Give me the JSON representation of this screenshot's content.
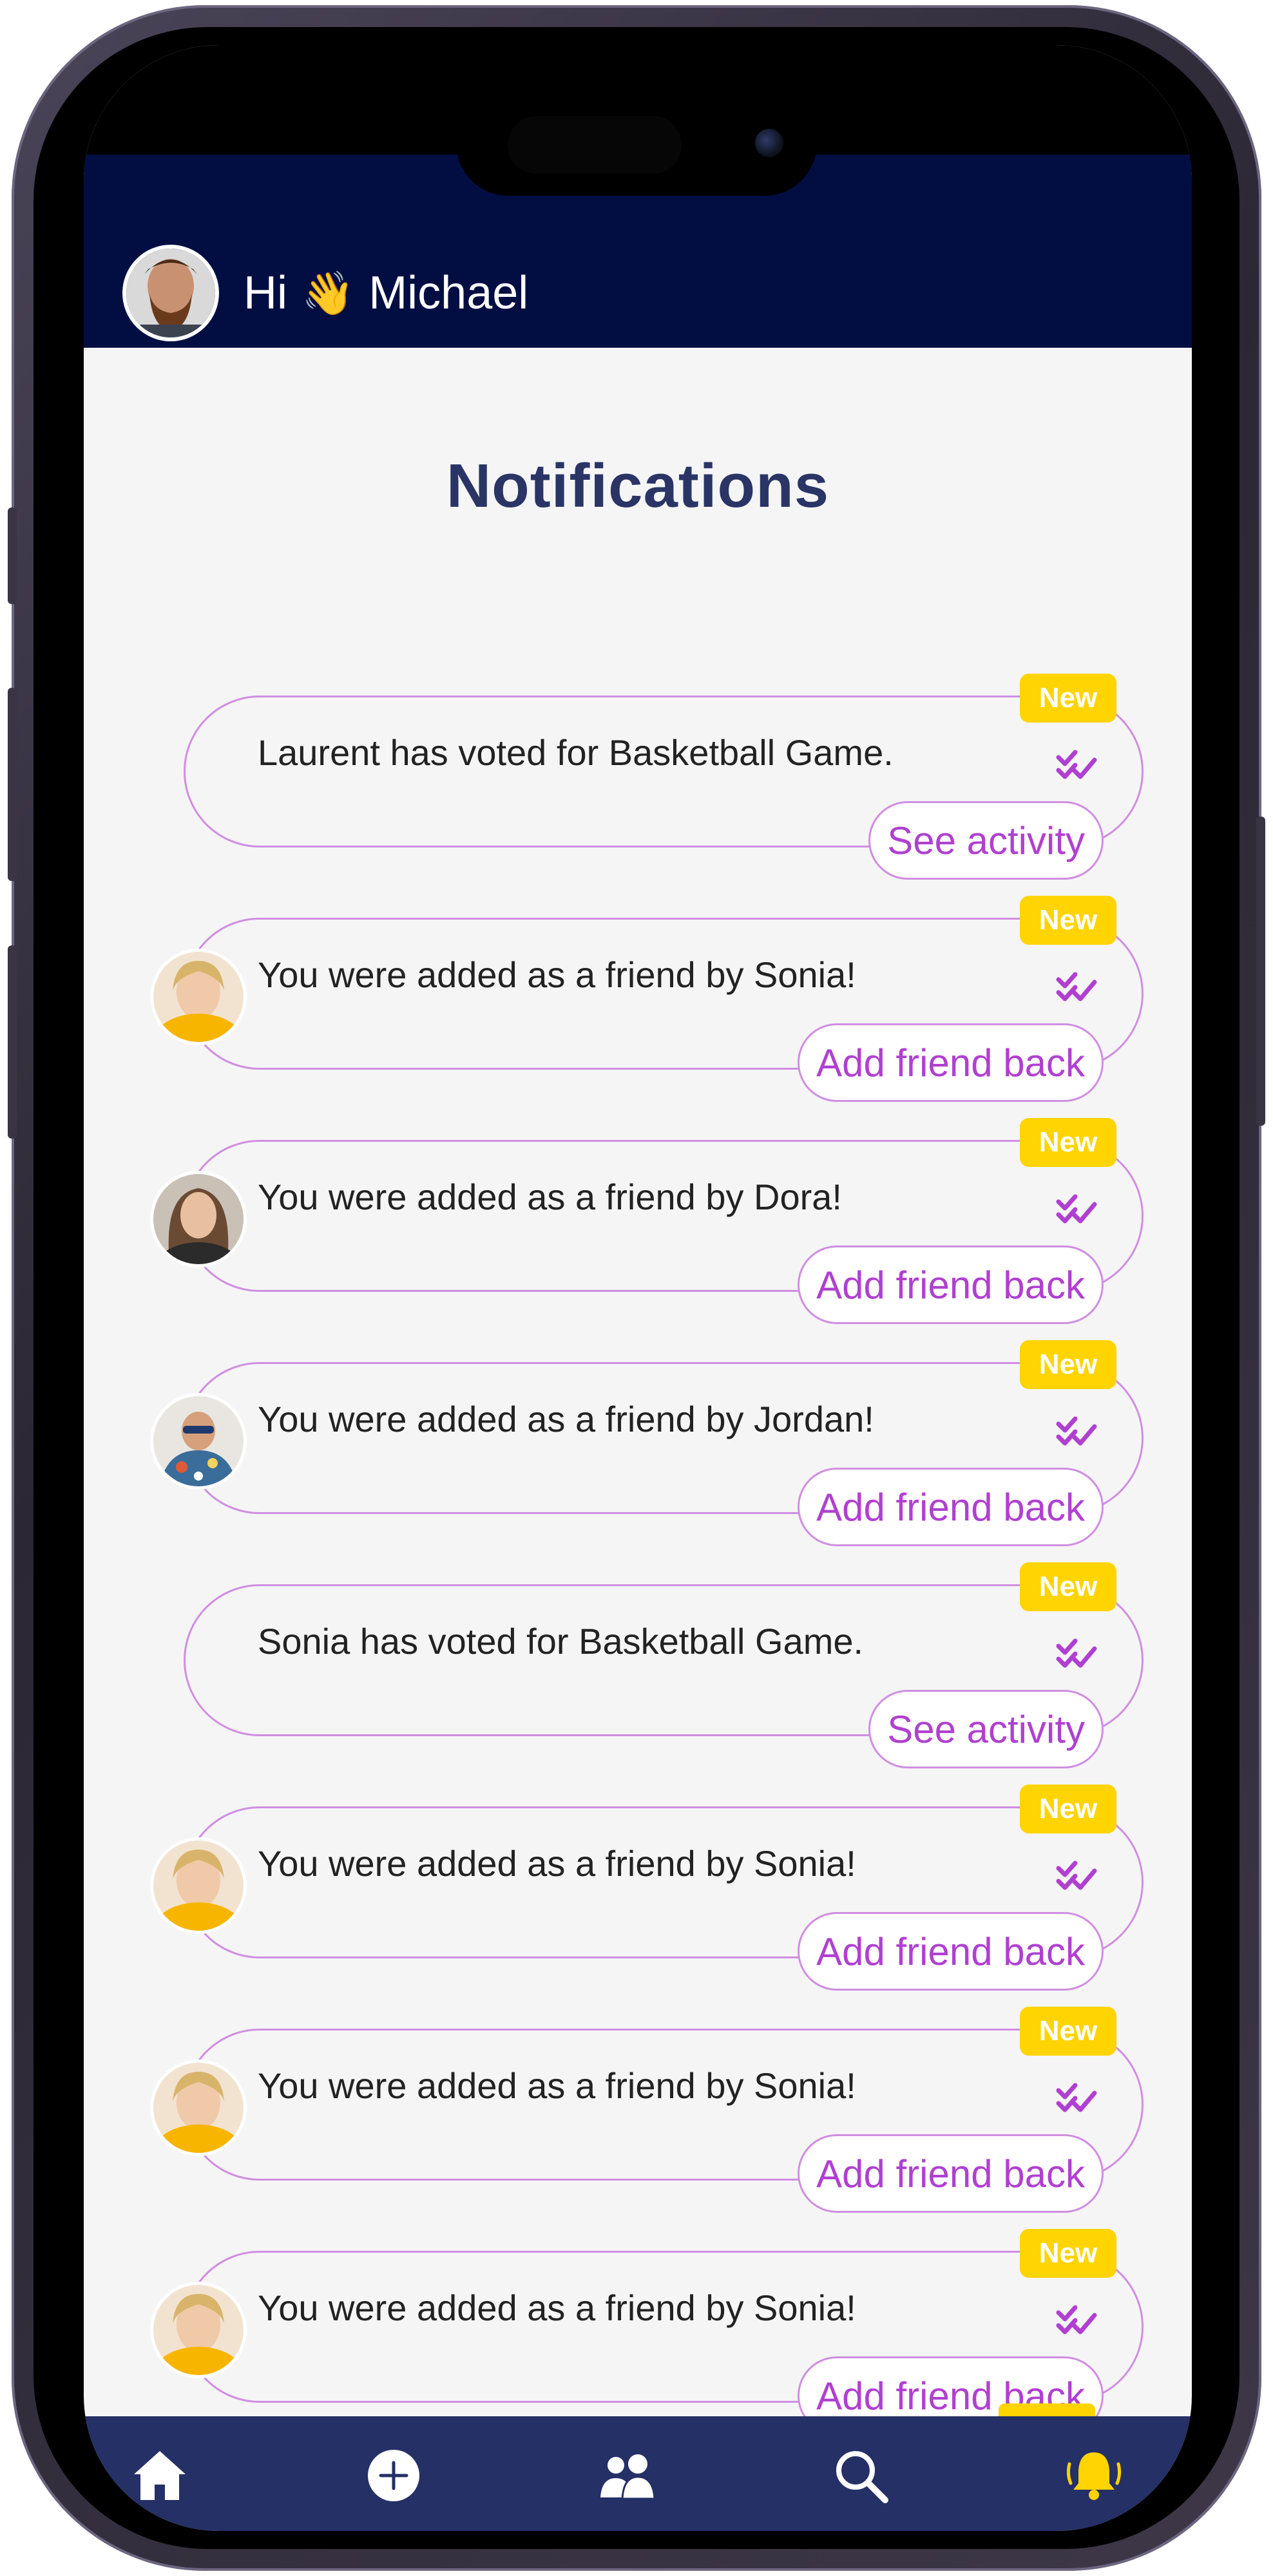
{
  "header": {
    "greeting": "Hi",
    "wave_emoji": "👋",
    "user_name": "Michael"
  },
  "page": {
    "title": "Notifications"
  },
  "badge_label": "New",
  "notifications": [
    {
      "message": "Laurent has voted for Basketball Game.",
      "action": "See activity",
      "avatar": null
    },
    {
      "message": "You were added as a friend by Sonia!",
      "action": "Add friend back",
      "avatar": "sonia-avatar"
    },
    {
      "message": "You were added as a friend by Dora!",
      "action": "Add friend back",
      "avatar": "dora-avatar"
    },
    {
      "message": "You were added as a friend by Jordan!",
      "action": "Add friend back",
      "avatar": "jordan-avatar"
    },
    {
      "message": "Sonia has voted for Basketball Game.",
      "action": "See activity",
      "avatar": null
    },
    {
      "message": "You were added as a friend by Sonia!",
      "action": "Add friend back",
      "avatar": "sonia-avatar"
    },
    {
      "message": "You were added as a friend by Sonia!",
      "action": "Add friend back",
      "avatar": "sonia-avatar"
    },
    {
      "message": "You were added as a friend by Sonia!",
      "action": "Add friend back",
      "avatar": "sonia-avatar"
    }
  ],
  "nav": {
    "items": [
      {
        "icon": "home-icon"
      },
      {
        "icon": "add-circle-icon"
      },
      {
        "icon": "friends-icon"
      },
      {
        "icon": "search-icon"
      },
      {
        "icon": "bell-icon",
        "active": true
      }
    ]
  },
  "colors": {
    "header_bg": "#020e42",
    "nav_bg": "#253066",
    "title": "#2a3566",
    "accent_purple": "#b040d0",
    "outline_purple": "#d08ee0",
    "badge_yellow": "#ffd400",
    "bell_active": "#ffd400"
  }
}
